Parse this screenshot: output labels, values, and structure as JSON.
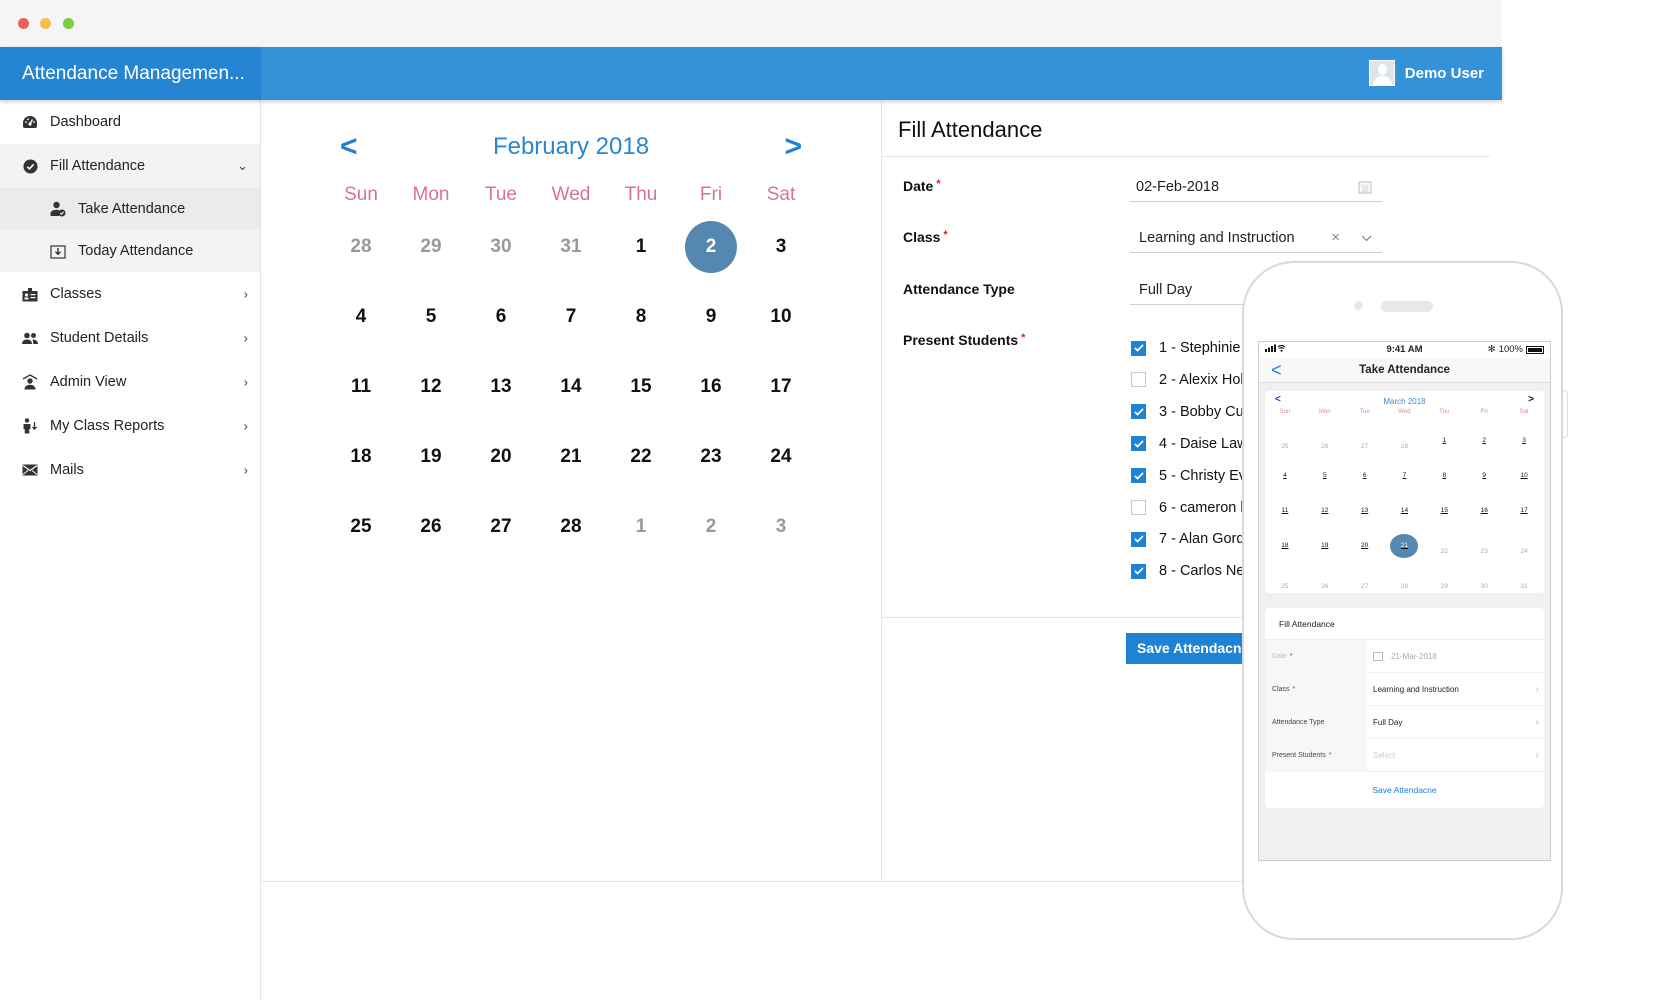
{
  "window": {
    "controls": [
      "close",
      "minimize",
      "maximize"
    ]
  },
  "header": {
    "app_title": "Attendance Managemen...",
    "user_name": "Demo User",
    "brand_color": "#2585d2",
    "bar_color": "#3392d8"
  },
  "sidebar": {
    "items": [
      {
        "label": "Dashboard",
        "icon": "dashboard-icon",
        "chevron": ""
      },
      {
        "label": "Fill Attendance",
        "icon": "check-circle-icon",
        "chevron": "⌄"
      },
      {
        "label": "Take Attendance",
        "icon": "user-check-icon",
        "sub": true
      },
      {
        "label": "Today Attendance",
        "icon": "download-box-icon",
        "sub": true
      },
      {
        "label": "Classes",
        "icon": "id-card-icon",
        "chevron": "›"
      },
      {
        "label": "Student Details",
        "icon": "users-icon",
        "chevron": "›"
      },
      {
        "label": "Admin View",
        "icon": "admin-user-icon",
        "chevron": "›"
      },
      {
        "label": "My Class Reports",
        "icon": "report-user-icon",
        "chevron": "›"
      },
      {
        "label": "Mails",
        "icon": "mail-icon",
        "chevron": "›"
      }
    ]
  },
  "calendar": {
    "prev": "<",
    "next": ">",
    "title": "February 2018",
    "weekdays": [
      "Sun",
      "Mon",
      "Tue",
      "Wed",
      "Thu",
      "Fri",
      "Sat"
    ],
    "weeks": [
      [
        {
          "d": "28",
          "m": true
        },
        {
          "d": "29",
          "m": true
        },
        {
          "d": "30",
          "m": true
        },
        {
          "d": "31",
          "m": true
        },
        {
          "d": "1"
        },
        {
          "d": "2",
          "s": true
        },
        {
          "d": "3"
        }
      ],
      [
        {
          "d": "4"
        },
        {
          "d": "5"
        },
        {
          "d": "6"
        },
        {
          "d": "7"
        },
        {
          "d": "8"
        },
        {
          "d": "9"
        },
        {
          "d": "10"
        }
      ],
      [
        {
          "d": "11"
        },
        {
          "d": "12"
        },
        {
          "d": "13"
        },
        {
          "d": "14"
        },
        {
          "d": "15"
        },
        {
          "d": "16"
        },
        {
          "d": "17"
        }
      ],
      [
        {
          "d": "18"
        },
        {
          "d": "19"
        },
        {
          "d": "20"
        },
        {
          "d": "21"
        },
        {
          "d": "22"
        },
        {
          "d": "23"
        },
        {
          "d": "24"
        }
      ],
      [
        {
          "d": "25"
        },
        {
          "d": "26"
        },
        {
          "d": "27"
        },
        {
          "d": "28"
        },
        {
          "d": "1",
          "m": true
        },
        {
          "d": "2",
          "m": true
        },
        {
          "d": "3",
          "m": true
        }
      ]
    ],
    "selected_color": "#5687b0",
    "weekday_color": "#d97392"
  },
  "form": {
    "title": "Fill Attendance",
    "date_label": "Date",
    "date_value": "02-Feb-2018",
    "class_label": "Class",
    "class_value": "Learning and Instruction",
    "clear_glyph": "×",
    "type_label": "Attendance Type",
    "type_value": "Full Day",
    "students_label": "Present Students",
    "required_mark": "*",
    "students": [
      {
        "label": "1 - Stephinie I",
        "checked": true
      },
      {
        "label": "2 - Alexix Hol",
        "checked": false
      },
      {
        "label": "3 - Bobby Cur",
        "checked": true
      },
      {
        "label": "4 - Daise Law",
        "checked": true
      },
      {
        "label": "5 - Christy Ev",
        "checked": true
      },
      {
        "label": "6 - cameron h",
        "checked": false
      },
      {
        "label": "7 - Alan Gord",
        "checked": true
      },
      {
        "label": "8 - Carlos Nev",
        "checked": true
      }
    ],
    "save_label": "Save Attendacne",
    "accent": "#1e83d4"
  },
  "phone": {
    "status_time": "9:41 AM",
    "battery": "100%",
    "nav_title": "Take Attendance",
    "back": "<",
    "cal_prev": "<",
    "cal_next": ">",
    "cal_title": "March 2018",
    "weekdays": [
      "Sun",
      "Mon",
      "Tue",
      "Wed",
      "Thu",
      "Fri",
      "Sat"
    ],
    "weeks": [
      [
        {
          "d": "25",
          "m": true
        },
        {
          "d": "26",
          "m": true
        },
        {
          "d": "27",
          "m": true
        },
        {
          "d": "28",
          "m": true
        },
        {
          "d": "1"
        },
        {
          "d": "2"
        },
        {
          "d": "3"
        }
      ],
      [
        {
          "d": "4"
        },
        {
          "d": "5"
        },
        {
          "d": "6"
        },
        {
          "d": "7"
        },
        {
          "d": "8"
        },
        {
          "d": "9"
        },
        {
          "d": "10"
        }
      ],
      [
        {
          "d": "11"
        },
        {
          "d": "12"
        },
        {
          "d": "13"
        },
        {
          "d": "14"
        },
        {
          "d": "15"
        },
        {
          "d": "16"
        },
        {
          "d": "17"
        }
      ],
      [
        {
          "d": "18"
        },
        {
          "d": "19"
        },
        {
          "d": "20"
        },
        {
          "d": "21",
          "s": true
        },
        {
          "d": "22",
          "m": true
        },
        {
          "d": "23",
          "m": true
        },
        {
          "d": "24",
          "m": true
        }
      ],
      [
        {
          "d": "25",
          "m": true
        },
        {
          "d": "26",
          "m": true
        },
        {
          "d": "27",
          "m": true
        },
        {
          "d": "28",
          "m": true
        },
        {
          "d": "29",
          "m": true
        },
        {
          "d": "30",
          "m": true
        },
        {
          "d": "31",
          "m": true
        }
      ]
    ],
    "form_title": "Fill Attendance",
    "date_label": "Date",
    "date_value": "21-Mar-2018",
    "class_label": "Class",
    "class_value": "Learning and Instruction",
    "type_label": "Attendance Type",
    "type_value": "Full Day",
    "students_label": "Present Students",
    "students_placeholder": "Select",
    "required_mark": "*",
    "save_label": "Save Attendacne"
  }
}
